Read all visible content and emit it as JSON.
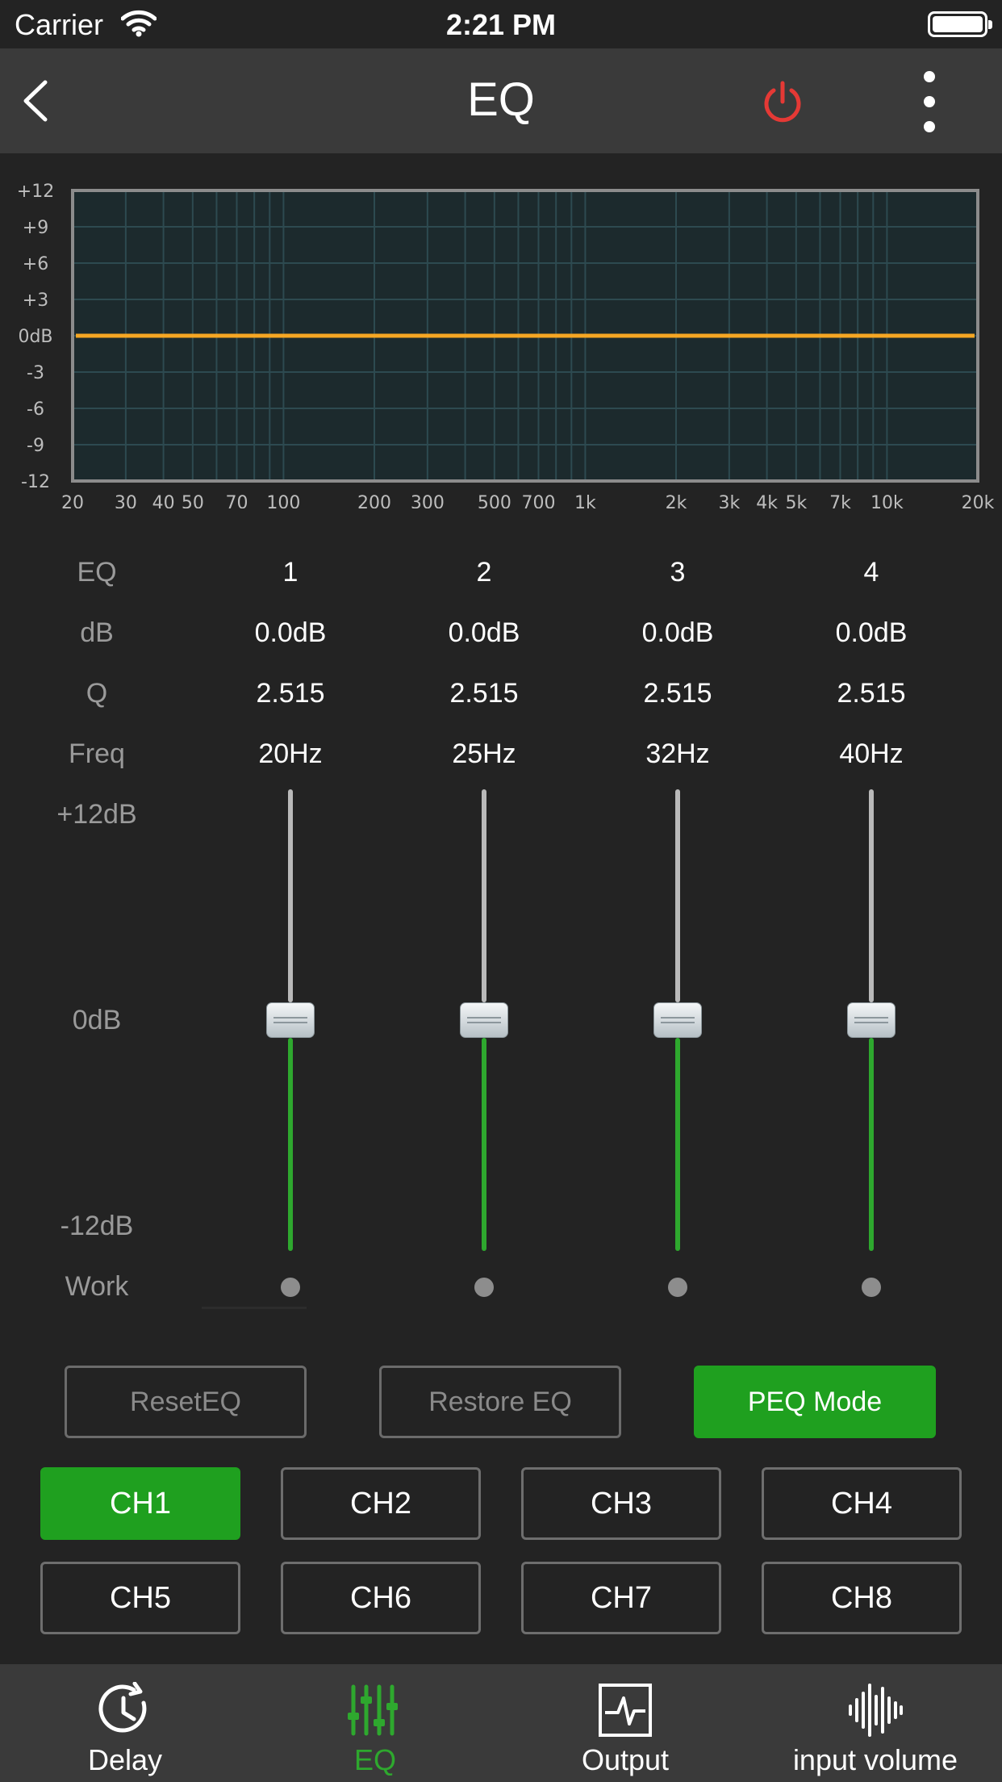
{
  "status": {
    "carrier": "Carrier",
    "time": "2:21 PM"
  },
  "nav": {
    "title": "EQ",
    "icons": [
      "back-chevron-icon",
      "power-icon",
      "more-vertical-icon"
    ],
    "power_color": "#e53935"
  },
  "graph": {
    "y_labels": [
      "+12",
      "+9",
      "+6",
      "+3",
      "0dB",
      "-3",
      "-6",
      "-9",
      "-12"
    ],
    "x_labels": [
      "20",
      "30",
      "40",
      "50",
      "70",
      "100",
      "200",
      "300",
      "500",
      "700",
      "1k",
      "2k",
      "3k",
      "4k",
      "5k",
      "7k",
      "10k",
      "20k"
    ],
    "curve_db": 0,
    "curve_color": "#f5a623"
  },
  "table": {
    "labels": {
      "eq": "EQ",
      "db": "dB",
      "q": "Q",
      "freq": "Freq"
    },
    "bands": [
      {
        "num": "1",
        "db": "0.0dB",
        "q": "2.515",
        "freq": "20Hz"
      },
      {
        "num": "2",
        "db": "0.0dB",
        "q": "2.515",
        "freq": "25Hz"
      },
      {
        "num": "3",
        "db": "0.0dB",
        "q": "2.515",
        "freq": "32Hz"
      },
      {
        "num": "4",
        "db": "0.0dB",
        "q": "2.515",
        "freq": "40Hz"
      }
    ]
  },
  "sliders": {
    "top_label": "+12dB",
    "mid_label": "0dB",
    "bottom_label": "-12dB",
    "work_label": "Work",
    "levels_db": [
      0,
      0,
      0,
      0
    ]
  },
  "actions": {
    "reset": "ResetEQ",
    "restore": "Restore EQ",
    "peq": "PEQ Mode"
  },
  "channels": [
    "CH1",
    "CH2",
    "CH3",
    "CH4",
    "CH5",
    "CH6",
    "CH7",
    "CH8"
  ],
  "active_channel": "CH1",
  "tabs": [
    {
      "label": "Delay",
      "icon": "clock-icon"
    },
    {
      "label": "EQ",
      "icon": "sliders-icon"
    },
    {
      "label": "Output",
      "icon": "waveform-box-icon"
    },
    {
      "label": "input volume",
      "icon": "sound-wave-icon"
    }
  ],
  "active_tab": "EQ",
  "colors": {
    "accent_green": "#1fa01f",
    "background": "#232323",
    "bar": "#3a3a3a"
  }
}
